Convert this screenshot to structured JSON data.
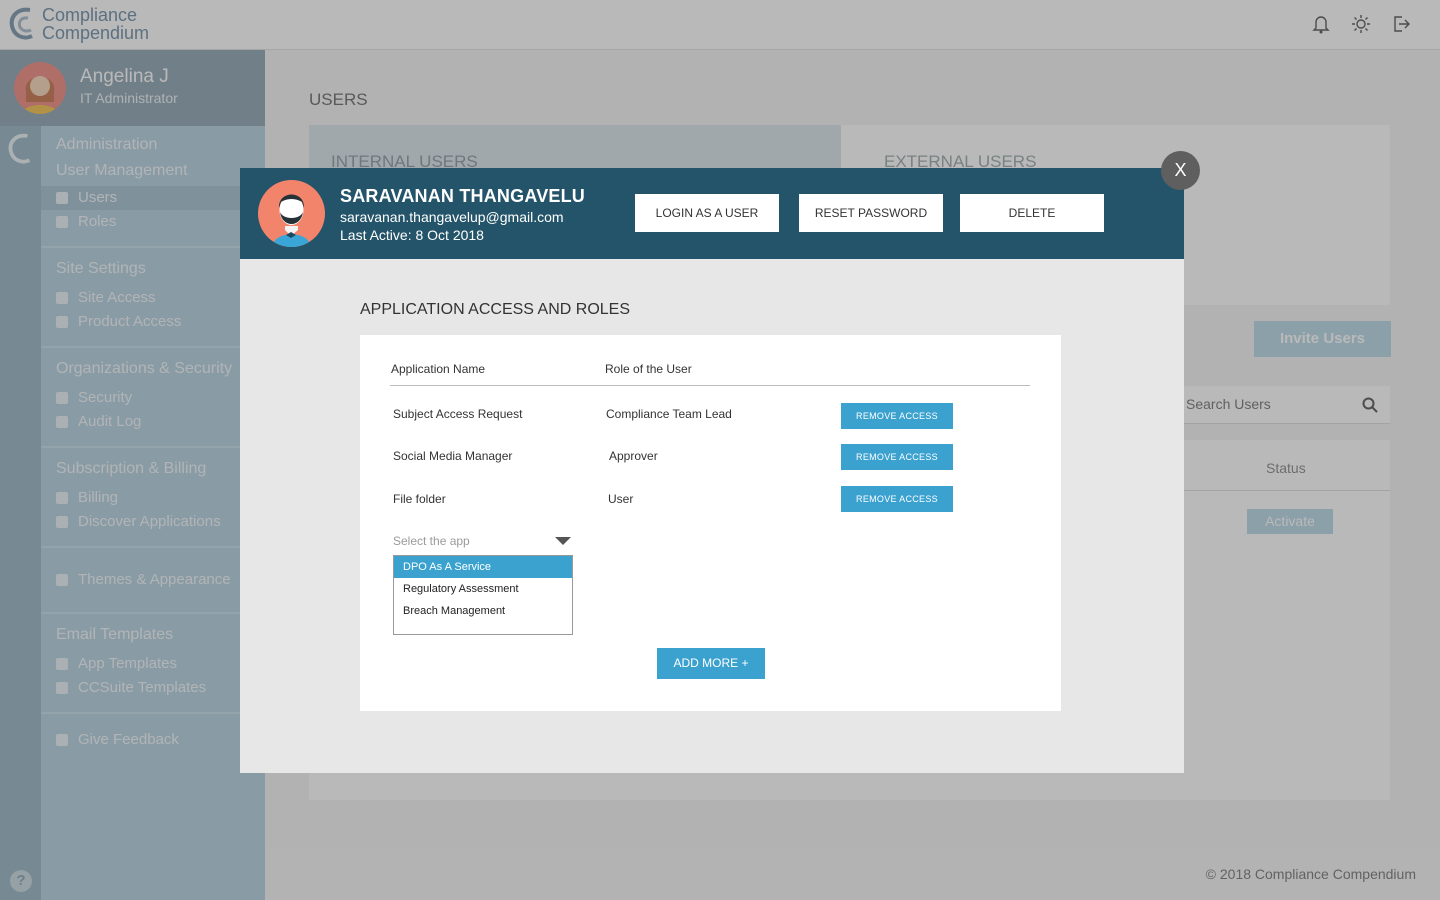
{
  "app": {
    "logo_line1": "Compliance",
    "logo_line2": "Compendium",
    "footer": "© 2018 Compliance Compendium"
  },
  "profile": {
    "name": "Angelina J",
    "role": "IT Administrator"
  },
  "sidebar": {
    "administration": "Administration",
    "user_management": "User Management",
    "users": "Users",
    "roles": "Roles",
    "site_settings": "Site Settings",
    "site_access": "Site Access",
    "product_access": "Product Access",
    "org_security": "Organizations & Security",
    "security": "Security",
    "audit_log": "Audit Log",
    "subscription_billing": "Subscription & Billing",
    "billing": "Billing",
    "discover_apps": "Discover Applications",
    "themes": "Themes & Appearance",
    "email_templates": "Email Templates",
    "app_templates": "App Templates",
    "ccsuite_templates": "CCSuite Templates",
    "give_feedback": "Give Feedback"
  },
  "main": {
    "title": "USERS",
    "tab_internal": "INTERNAL USERS",
    "tab_external": "EXTERNAL USERS",
    "invite_users": "Invite Users",
    "search_placeholder": "Search Users",
    "status_header": "Status",
    "activate": "Activate"
  },
  "modal": {
    "close": "X",
    "user_name": "SARAVANAN THANGAVELU",
    "user_email": "saravanan.thangavelup@gmail.com",
    "last_active": "Last Active: 8 Oct 2018",
    "login_as_user": "LOGIN AS A USER",
    "reset_password": "RESET PASSWORD",
    "delete": "DELETE",
    "section_title": "APPLICATION ACCESS AND ROLES",
    "col_app": "Application Name",
    "col_role": "Role of the User",
    "rows": [
      {
        "app": "Subject Access Request",
        "role": "Compliance Team Lead",
        "action": "REMOVE ACCESS"
      },
      {
        "app": "Social Media Manager",
        "role": "Approver",
        "action": "REMOVE ACCESS"
      },
      {
        "app": "File folder",
        "role": "User",
        "action": "REMOVE ACCESS"
      }
    ],
    "select_placeholder": "Select the app",
    "options": [
      "DPO As A Service",
      "Regulatory Assessment",
      "Breach Management"
    ],
    "add_more": "ADD MORE +"
  },
  "colors": {
    "modal_header": "#245469",
    "accent_button": "#3ba2d0",
    "sidebar": "#b5d1df",
    "avatar": "#f2846c"
  },
  "icons": [
    "bell-icon",
    "sun-icon",
    "logout-icon",
    "user-icon",
    "roles-icon",
    "key-icon",
    "box-icon",
    "lock-icon",
    "document-icon",
    "euro-icon",
    "grid-icon",
    "palette-icon",
    "envelope-icon",
    "megaphone-icon",
    "search-icon",
    "help-icon"
  ]
}
